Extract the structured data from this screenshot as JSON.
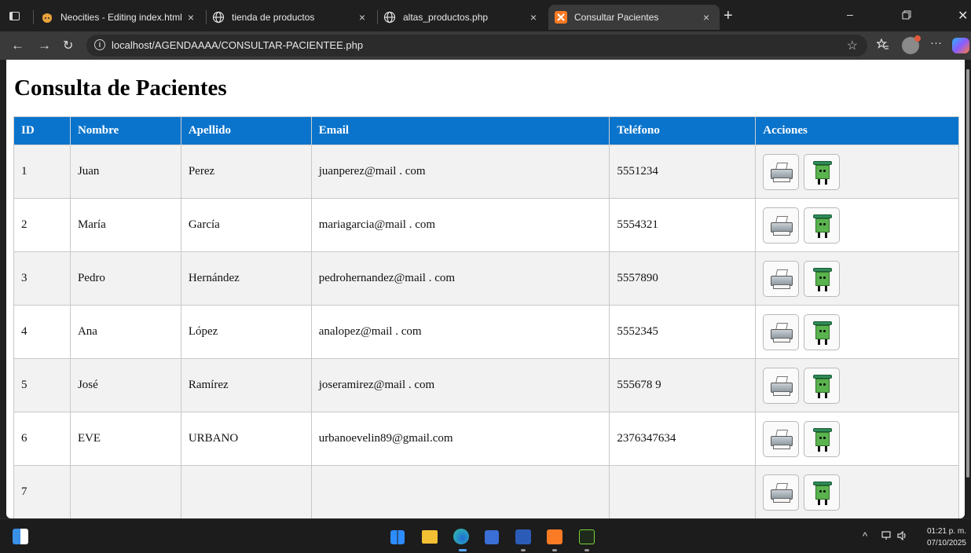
{
  "browser": {
    "tabs": [
      {
        "label": "Neocities - Editing index.html",
        "icon": "neocities-cat-icon"
      },
      {
        "label": "tienda de productos",
        "icon": "globe-icon"
      },
      {
        "label": "altas_productos.php",
        "icon": "globe-icon"
      },
      {
        "label": "Consultar Pacientes",
        "icon": "xampp-icon",
        "active": true
      }
    ],
    "close_glyph": "×",
    "new_tab_glyph": "+",
    "url": "localhost/AGENDAAAA/CONSULTAR-PACIENTEE.php"
  },
  "page": {
    "title": "Consulta de Pacientes",
    "columns": [
      "ID",
      "Nombre",
      "Apellido",
      "Email",
      "Teléfono",
      "Acciones"
    ],
    "rows": [
      {
        "id": "1",
        "nombre": "Juan",
        "apellido": "Perez",
        "email": "juanperez@mail . com",
        "telefono": "5551234"
      },
      {
        "id": "2",
        "nombre": "María",
        "apellido": "García",
        "email": "mariagarcia@mail . com",
        "telefono": "5554321"
      },
      {
        "id": "3",
        "nombre": "Pedro",
        "apellido": "Hernández",
        "email": "pedrohernandez@mail . com",
        "telefono": "5557890"
      },
      {
        "id": "4",
        "nombre": "Ana",
        "apellido": "López",
        "email": "analopez@mail . com",
        "telefono": "5552345"
      },
      {
        "id": "5",
        "nombre": "José",
        "apellido": "Ramírez",
        "email": "joseramirez@mail . com",
        "telefono": "555678 9"
      },
      {
        "id": "6",
        "nombre": "EVE",
        "apellido": "URBANO",
        "email": "urbanoevelin89@gmail.com",
        "telefono": "2376347634"
      },
      {
        "id": "7",
        "nombre": "",
        "apellido": "",
        "email": "",
        "telefono": ""
      }
    ],
    "header_color": "#0a74cc"
  },
  "taskbar": {
    "time": "01:21 p. m.",
    "date": "07/10/2025"
  }
}
